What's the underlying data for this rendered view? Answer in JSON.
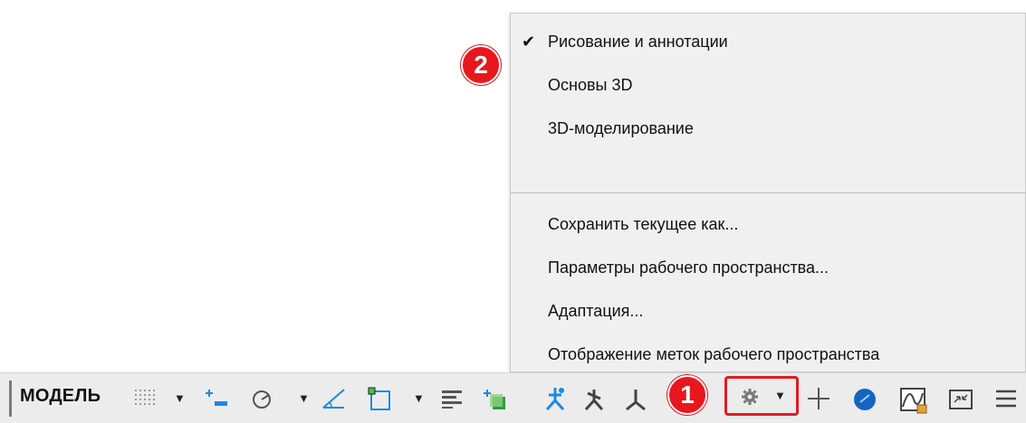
{
  "workspace_menu": {
    "items": [
      {
        "label": "Рисование и аннотации",
        "checked": true,
        "check_glyph": "✔"
      },
      {
        "label": "Основы 3D",
        "checked": false
      },
      {
        "label": "3D-моделирование",
        "checked": false
      }
    ],
    "actions": [
      {
        "label": "Сохранить текущее как..."
      },
      {
        "label": "Параметры рабочего пространства..."
      },
      {
        "label": "Адаптация..."
      },
      {
        "label": "Отображение меток рабочего пространства"
      }
    ]
  },
  "callouts": {
    "badge_1": "1",
    "badge_2": "2",
    "color": "#e8171d"
  },
  "statusbar": {
    "model_label": "МОДЕЛЬ",
    "icons": [
      "grid-display-icon",
      "snap-mode-icon",
      "ortho-mode-icon",
      "polar-tracking-icon",
      "isodraft-icon",
      "object-snap-icon",
      "lineweight-icon",
      "transparency-icon",
      "annotation-scale-icon",
      "annotation-visibility-icon",
      "auto-scale-icon",
      "workspace-switching-icon",
      "annotation-monitor-icon",
      "isolate-objects-icon",
      "hardware-acceleration-icon",
      "clean-screen-icon",
      "customization-menu-icon"
    ],
    "accent": "#1e88e5"
  }
}
